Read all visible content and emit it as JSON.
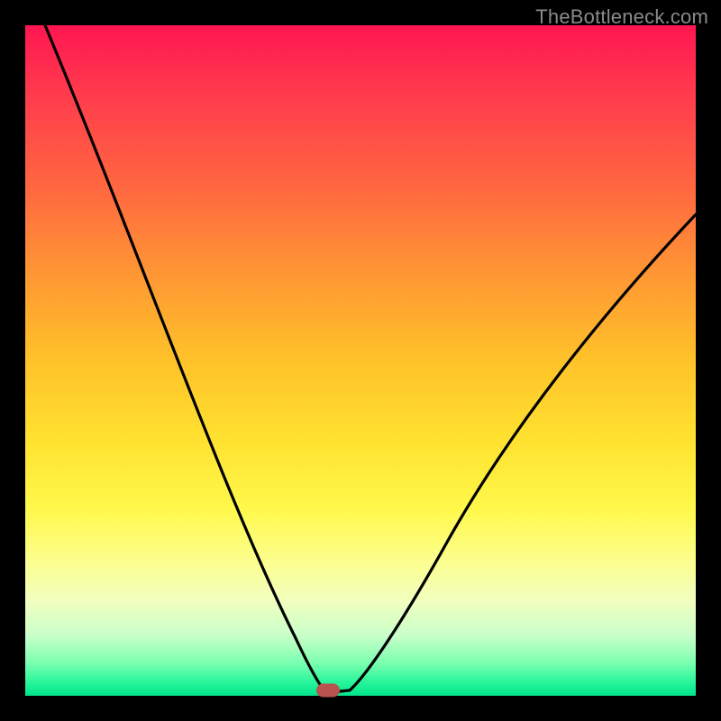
{
  "watermark": "TheBottleneck.com",
  "chart_data": {
    "type": "line",
    "title": "",
    "xlabel": "",
    "ylabel": "",
    "xlim": [
      0,
      100
    ],
    "ylim": [
      0,
      100
    ],
    "grid": false,
    "legend": false,
    "series": [
      {
        "name": "left-branch",
        "x": [
          3,
          10,
          17,
          24,
          31,
          36,
          40,
          43,
          45
        ],
        "y": [
          100,
          80,
          60,
          40,
          20,
          8,
          2,
          0,
          0
        ]
      },
      {
        "name": "right-branch",
        "x": [
          45,
          48,
          52,
          58,
          66,
          76,
          88,
          100
        ],
        "y": [
          0,
          0,
          4,
          12,
          26,
          42,
          58,
          72
        ]
      }
    ],
    "marker": {
      "x": 45,
      "y": 0,
      "color": "#b8534d"
    },
    "background_gradient": {
      "orientation": "vertical",
      "top": "#ff1651",
      "bottom": "#00e58c"
    }
  }
}
